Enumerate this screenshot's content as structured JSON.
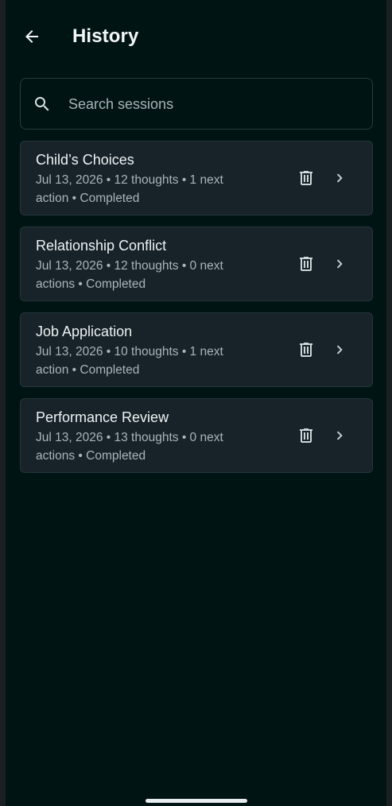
{
  "app_bar": {
    "title": "History",
    "back_icon": "arrow-left-icon"
  },
  "search": {
    "placeholder": "Search sessions",
    "value": "",
    "icon": "search-icon"
  },
  "sessions": [
    {
      "title": "Child’s Choices",
      "meta": "Jul 13, 2026 • 12 thoughts • 1 next action • Completed"
    },
    {
      "title": "Relationship Conflict",
      "meta": "Jul 13, 2026 • 12 thoughts • 0 next actions • Completed"
    },
    {
      "title": "Job Application",
      "meta": "Jul 13, 2026 • 10 thoughts • 1 next action • Completed"
    },
    {
      "title": "Performance Review",
      "meta": "Jul 13, 2026 • 13 thoughts • 0 next actions • Completed"
    }
  ],
  "colors": {
    "background": "#011414",
    "card": "#172329",
    "text_primary": "#eef3f4",
    "text_secondary": "#a9b5ba"
  }
}
